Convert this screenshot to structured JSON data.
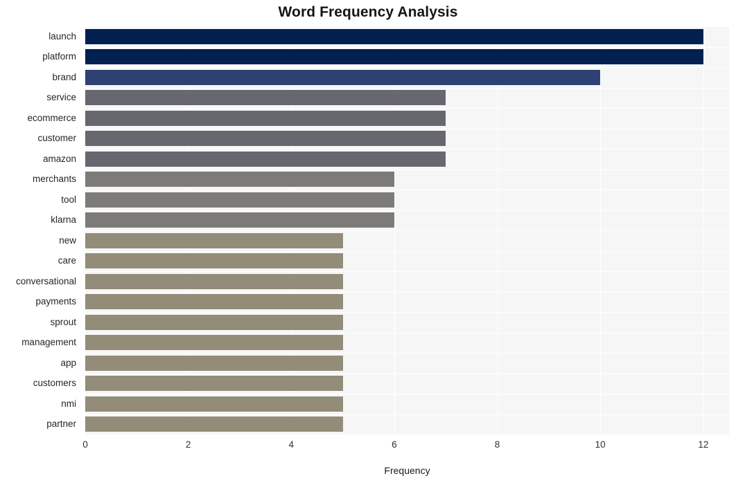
{
  "chart": {
    "title": "Word Frequency Analysis",
    "xlabel": "Frequency",
    "ylabel": ""
  },
  "axis": {
    "x_ticks": [
      "0",
      "2",
      "4",
      "6",
      "8",
      "10",
      "12"
    ]
  },
  "colors": {
    "background": "#ffffff",
    "plot_background": "#f6f6f7",
    "gridline": "#ffffff",
    "title_text": "#151515",
    "tick_text": "#303030",
    "bar_navy_dark": "#002050",
    "bar_navy_medium": "#2e4272",
    "bar_gray_dark": "#66676f",
    "bar_gray_medium": "#7c7b77",
    "bar_khaki": "#938c78"
  },
  "chart_data": {
    "type": "bar",
    "orientation": "horizontal",
    "title": "Word Frequency Analysis",
    "xlabel": "Frequency",
    "ylabel": "",
    "xlim": [
      0,
      12.5
    ],
    "xticks": [
      0,
      2,
      4,
      6,
      8,
      10,
      12
    ],
    "grid": true,
    "legend": "none",
    "categories": [
      "launch",
      "platform",
      "brand",
      "service",
      "ecommerce",
      "customer",
      "amazon",
      "merchants",
      "tool",
      "klarna",
      "new",
      "care",
      "conversational",
      "payments",
      "sprout",
      "management",
      "app",
      "customers",
      "nmi",
      "partner"
    ],
    "values": [
      12,
      12,
      10,
      7,
      7,
      7,
      7,
      6,
      6,
      6,
      5,
      5,
      5,
      5,
      5,
      5,
      5,
      5,
      5,
      5
    ],
    "bar_colors": [
      "#002050",
      "#002050",
      "#2e4272",
      "#66676f",
      "#66676f",
      "#66676f",
      "#66676f",
      "#7c7b77",
      "#7c7b77",
      "#7c7b77",
      "#938c78",
      "#938c78",
      "#938c78",
      "#938c78",
      "#938c78",
      "#938c78",
      "#938c78",
      "#938c78",
      "#938c78",
      "#938c78"
    ]
  }
}
